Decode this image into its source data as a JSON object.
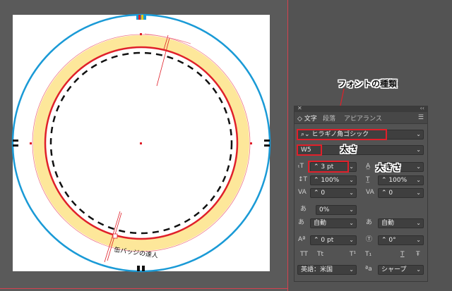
{
  "artwork": {
    "badge_text": "缶バッジの達人",
    "colors": {
      "blue_ring": "#1a9ad6",
      "red_ring": "#e0202a",
      "yellow_band": "#fde79a",
      "guide_pink": "#f07a8a"
    }
  },
  "panel": {
    "close_glyph": "✕",
    "collapse_glyph": "‹‹",
    "menu_glyph": "☰",
    "tabs": [
      {
        "label": "◇ 文字",
        "active": true
      },
      {
        "label": "段落",
        "active": false
      },
      {
        "label": "アピアランス",
        "active": false
      }
    ],
    "font_family": "ヒラギノ角ゴシック",
    "font_style": "W5",
    "font_size": "3 pt",
    "leading": "",
    "vertical_scale": "100%",
    "horizontal_scale": "100%",
    "kerning": "0",
    "tracking": "0",
    "tsume": "0%",
    "aki_left": "自動",
    "aki_right": "自動",
    "baseline_shift": "0 pt",
    "rotation": "0°",
    "text_buttons": [
      "TT",
      "Tt",
      "T¹",
      "T₁",
      "T",
      "Ŧ"
    ],
    "language": "英語：米国",
    "aa_label": "ªa",
    "antialias": "シャープ"
  },
  "callouts": {
    "font_type": "フォントの種類",
    "weight": "太さ",
    "size": "大きさ"
  }
}
